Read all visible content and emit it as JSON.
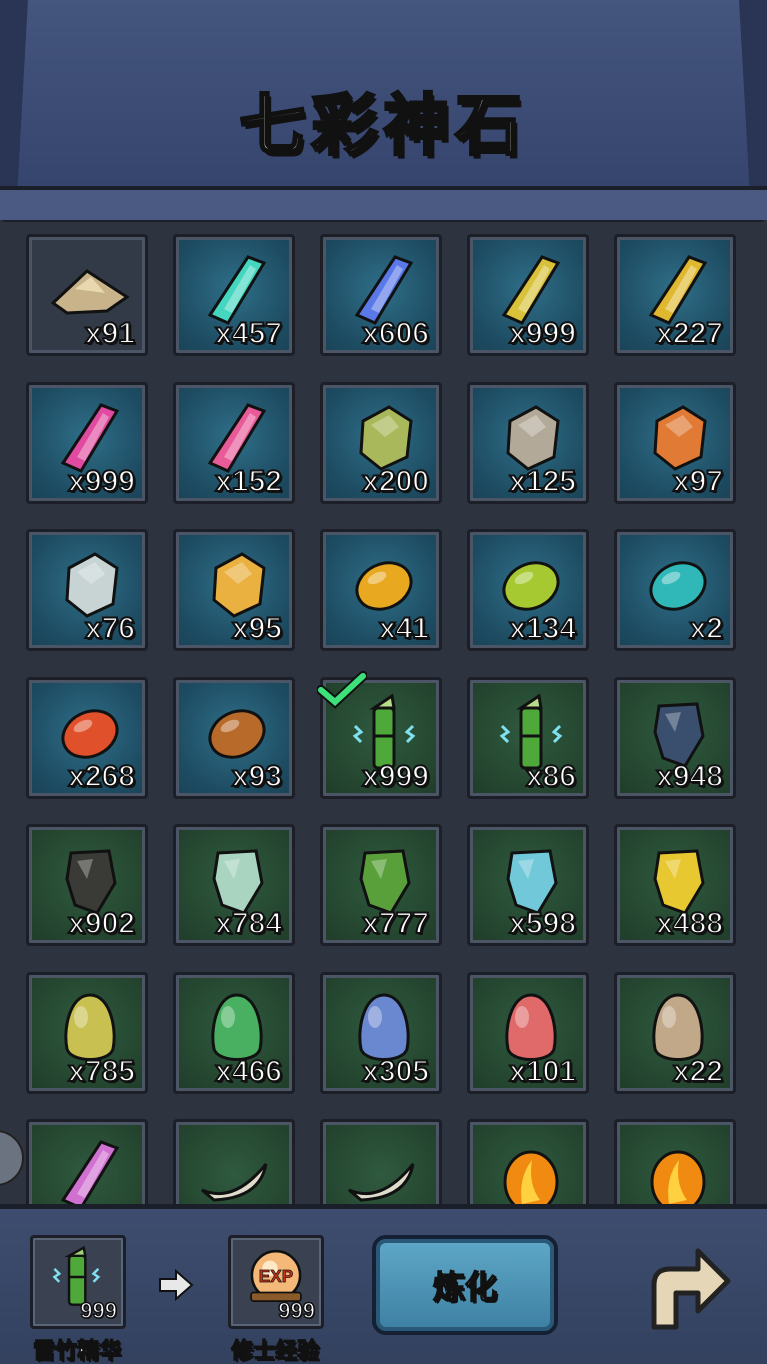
{
  "title": "七彩神石",
  "items": [
    {
      "count": "x91",
      "bg": "dark",
      "icon": "sand-pile",
      "color": "#c9b38a",
      "shape": "pile"
    },
    {
      "count": "x457",
      "bg": "blue",
      "icon": "cyan-crystal",
      "color": "#45d6c0",
      "shape": "crystal"
    },
    {
      "count": "x606",
      "bg": "blue",
      "icon": "blue-crystal",
      "color": "#5a78e8",
      "shape": "crystal"
    },
    {
      "count": "x999",
      "bg": "blue",
      "icon": "yellow-crystal",
      "color": "#d8c23a",
      "shape": "crystal"
    },
    {
      "count": "x227",
      "bg": "blue",
      "icon": "gold-crystal",
      "color": "#e0b830",
      "shape": "crystal"
    },
    {
      "count": "x999",
      "bg": "blue",
      "icon": "magenta-crystal",
      "color": "#e04aa0",
      "shape": "crystal"
    },
    {
      "count": "x152",
      "bg": "blue",
      "icon": "pink-crystal",
      "color": "#e85a98",
      "shape": "crystal"
    },
    {
      "count": "x200",
      "bg": "blue",
      "icon": "green-ore",
      "color": "#a9b85a",
      "shape": "rock"
    },
    {
      "count": "x125",
      "bg": "blue",
      "icon": "grey-ore",
      "color": "#b3a999",
      "shape": "rock"
    },
    {
      "count": "x97",
      "bg": "blue",
      "icon": "orange-ore",
      "color": "#e07a35",
      "shape": "rock"
    },
    {
      "count": "x76",
      "bg": "blue",
      "icon": "white-ore",
      "color": "#c8d4d4",
      "shape": "rock"
    },
    {
      "count": "x95",
      "bg": "blue",
      "icon": "amber-ore",
      "color": "#eab040",
      "shape": "rock"
    },
    {
      "count": "x41",
      "bg": "blue",
      "icon": "gold-pebble",
      "color": "#e8a820",
      "shape": "pebble"
    },
    {
      "count": "x134",
      "bg": "blue",
      "icon": "lime-pebble",
      "color": "#a6c830",
      "shape": "pebble"
    },
    {
      "count": "x2",
      "bg": "blue",
      "icon": "teal-pebble",
      "color": "#30b8b8",
      "shape": "pebble"
    },
    {
      "count": "x268",
      "bg": "blue",
      "icon": "red-pebble",
      "color": "#e0502a",
      "shape": "pebble"
    },
    {
      "count": "x93",
      "bg": "blue",
      "icon": "brown-pebble",
      "color": "#b86a2a",
      "shape": "pebble"
    },
    {
      "count": "x999",
      "bg": "green",
      "icon": "thunder-bamboo",
      "color": "#4ea83a",
      "shape": "bamboo",
      "checked": true
    },
    {
      "count": "x86",
      "bg": "green",
      "icon": "thunder-bamboo",
      "color": "#4ea83a",
      "shape": "bamboo"
    },
    {
      "count": "x948",
      "bg": "green",
      "icon": "navy-stone",
      "color": "#3a4e6e",
      "shape": "stone"
    },
    {
      "count": "x902",
      "bg": "green",
      "icon": "black-stone",
      "color": "#3a3a36",
      "shape": "stone"
    },
    {
      "count": "x784",
      "bg": "green",
      "icon": "jade-stone",
      "color": "#a8d4c0",
      "shape": "stone"
    },
    {
      "count": "x777",
      "bg": "green",
      "icon": "green-stone",
      "color": "#5aa03a",
      "shape": "stone"
    },
    {
      "count": "x598",
      "bg": "green",
      "icon": "sky-stone",
      "color": "#70c8d8",
      "shape": "stone"
    },
    {
      "count": "x488",
      "bg": "green",
      "icon": "yellow-stone",
      "color": "#e8c830",
      "shape": "stone"
    },
    {
      "count": "x785",
      "bg": "green",
      "icon": "olive-egg",
      "color": "#c8c050",
      "shape": "egg"
    },
    {
      "count": "x466",
      "bg": "green",
      "icon": "green-egg",
      "color": "#48b060",
      "shape": "egg"
    },
    {
      "count": "x305",
      "bg": "green",
      "icon": "blue-egg",
      "color": "#6a88d0",
      "shape": "egg"
    },
    {
      "count": "x101",
      "bg": "green",
      "icon": "pink-egg",
      "color": "#e06a6a",
      "shape": "egg"
    },
    {
      "count": "x22",
      "bg": "green",
      "icon": "tan-egg",
      "color": "#c0a888",
      "shape": "egg"
    },
    {
      "count": "",
      "bg": "green",
      "icon": "purple-crystal-scroll",
      "color": "#d070d0",
      "shape": "crystal"
    },
    {
      "count": "",
      "bg": "green",
      "icon": "horn",
      "color": "#e0dccc",
      "shape": "horn"
    },
    {
      "count": "",
      "bg": "green",
      "icon": "horn",
      "color": "#e0dccc",
      "shape": "horn"
    },
    {
      "count": "",
      "bg": "green",
      "icon": "flame-orb",
      "color": "#f08a10",
      "shape": "orb"
    },
    {
      "count": "",
      "bg": "green",
      "icon": "flame-orb",
      "color": "#f08a10",
      "shape": "orb"
    }
  ],
  "bottom": {
    "input_label": "雷竹精华",
    "input_count": "999",
    "output_label": "修士经验",
    "output_count": "999",
    "output_badge": "EXP",
    "refine_label": "炼化"
  }
}
